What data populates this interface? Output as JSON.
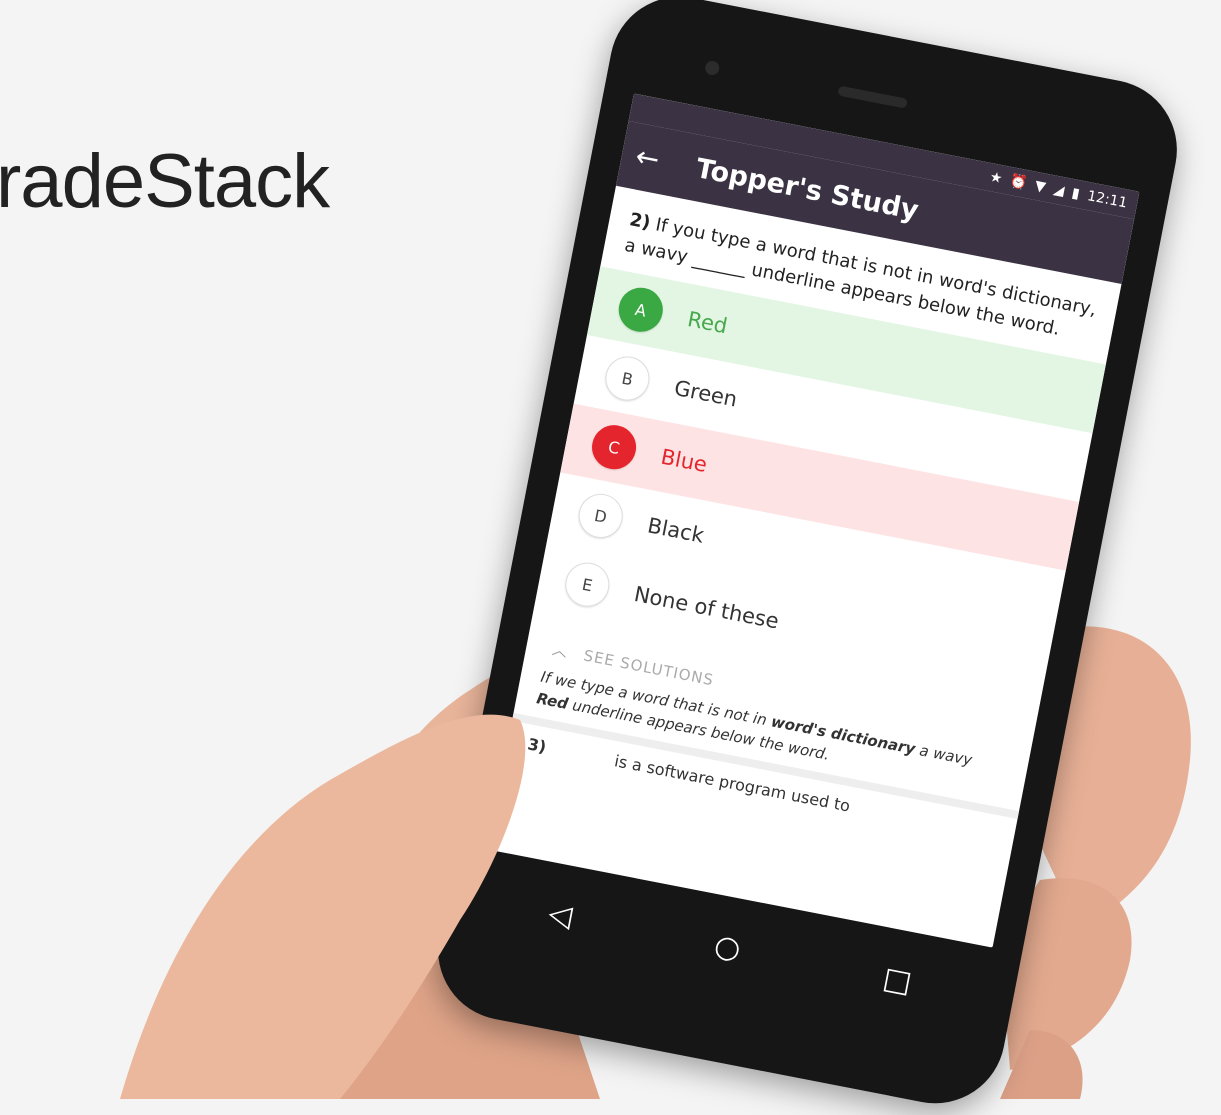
{
  "brand": {
    "text": "radeStack"
  },
  "status_bar": {
    "time": "12:11",
    "icons": [
      "star-icon",
      "alarm-icon",
      "wifi-icon",
      "signal-icon",
      "battery-icon"
    ]
  },
  "app_bar": {
    "back_icon": "arrow-left-icon",
    "title": "Topper's Study"
  },
  "question": {
    "number": "2)",
    "text": "If you type a word that is not in word's dictionary, a wavy ______ underline appears below the word."
  },
  "options": [
    {
      "letter": "A",
      "label": "Red",
      "state": "correct"
    },
    {
      "letter": "B",
      "label": "Green",
      "state": "none"
    },
    {
      "letter": "C",
      "label": "Blue",
      "state": "wrong"
    },
    {
      "letter": "D",
      "label": "Black",
      "state": "none"
    },
    {
      "letter": "E",
      "label": "None of these",
      "state": "none"
    }
  ],
  "solutions": {
    "toggle_label": "SEE SOLUTIONS",
    "text_before": "If we type a word that is not in ",
    "bold1": "word's dictionary",
    "text_mid": " a wavy ",
    "bold2": "Red",
    "text_after": " underline appears below the word."
  },
  "next_question": {
    "number": "3)",
    "text": "is a software program used to"
  },
  "colors": {
    "app_bar": "#3b3343",
    "correct": "#3aa843",
    "wrong": "#e5252d",
    "correct_bg": "#e3f5e3",
    "wrong_bg": "#fde3e3"
  }
}
